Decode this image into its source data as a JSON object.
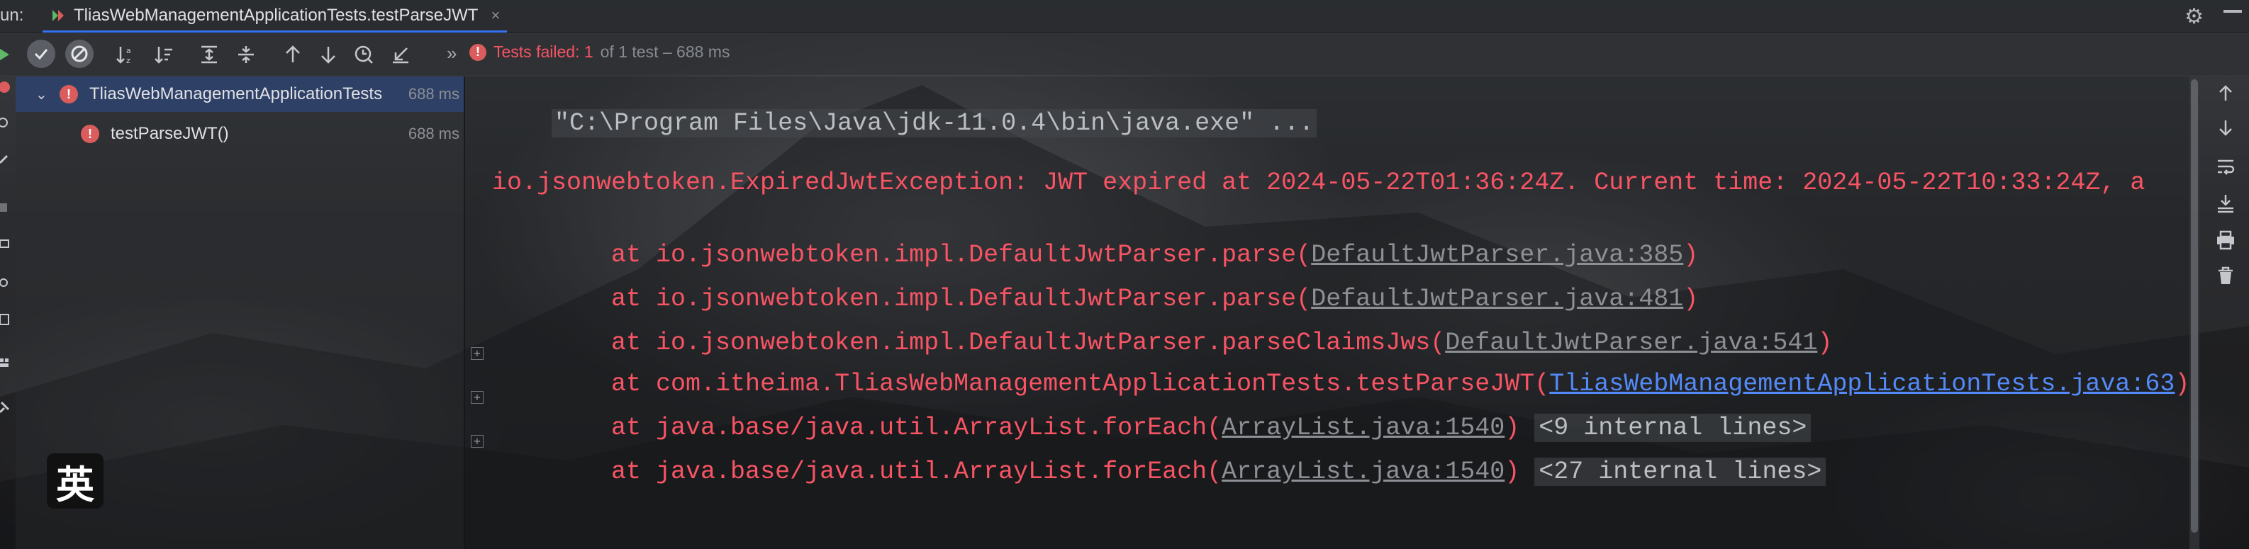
{
  "run_window": {
    "run_label": "un:",
    "tab_title": "TliasWebManagementApplicationTests.testParseJWT",
    "tab_close": "×"
  },
  "toolbar": {
    "error_count_badge": "!",
    "status_failed": "Tests failed: 1",
    "status_detail": "of 1 test – 688 ms",
    "more_chevron": "»"
  },
  "test_tree": {
    "items": [
      {
        "name": "TliasWebManagementApplicationTests",
        "time": "688 ms",
        "expanded_marker": "⌄"
      },
      {
        "name": "testParseJWT()",
        "time": "688 ms"
      }
    ]
  },
  "console": {
    "command_line": "\"C:\\Program Files\\Java\\jdk-11.0.4\\bin\\java.exe\" ...",
    "exception_line": "io.jsonwebtoken.ExpiredJwtException: JWT expired at 2024-05-22T01:36:24Z. Current time: 2024-05-22T10:33:24Z, a",
    "stack": [
      {
        "prefix": "    at io.jsonwebtoken.impl.DefaultJwtParser.parse(",
        "link": "DefaultJwtParser.java:385",
        "suffix": ")",
        "fold": ""
      },
      {
        "prefix": "    at io.jsonwebtoken.impl.DefaultJwtParser.parse(",
        "link": "DefaultJwtParser.java:481",
        "suffix": ")",
        "fold": ""
      },
      {
        "prefix": "    at io.jsonwebtoken.impl.DefaultJwtParser.parseClaimsJws(",
        "link": "DefaultJwtParser.java:541",
        "suffix": ")",
        "fold": ""
      },
      {
        "prefix": "    at com.itheima.TliasWebManagementApplicationTests.testParseJWT(",
        "link": "TliasWebManagementApplicationTests.java:63",
        "suffix": ")",
        "fold": ""
      },
      {
        "prefix": "    at java.base/java.util.ArrayList.forEach(",
        "link": "ArrayList.java:1540",
        "suffix": ") ",
        "fold": "<9 internal lines>"
      },
      {
        "prefix": "    at java.base/java.util.ArrayList.forEach(",
        "link": "ArrayList.java:1540",
        "suffix": ") ",
        "fold": "<27 internal lines>"
      }
    ]
  },
  "ime_badge": "英",
  "colors": {
    "error_red": "#f75464",
    "link_blue": "#548af7",
    "selection": "#2e436e"
  }
}
